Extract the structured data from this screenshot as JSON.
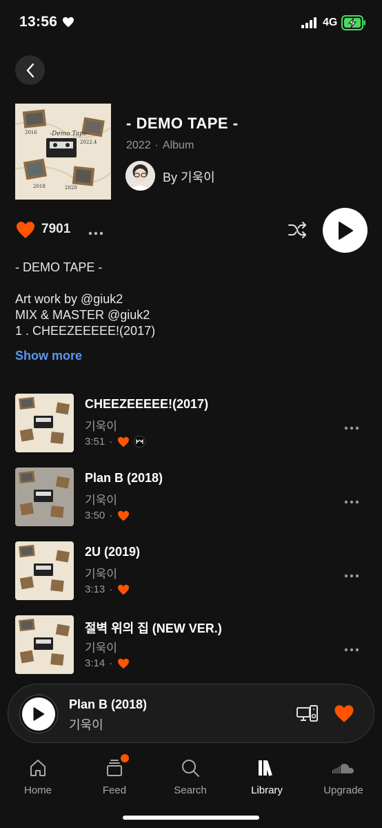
{
  "status_bar": {
    "time": "13:56",
    "network": "4G",
    "icons": [
      "heart-icon",
      "signal-icon",
      "battery-charging-icon"
    ]
  },
  "album": {
    "title": "- DEMO TAPE -",
    "year": "2022",
    "separator": "·",
    "type": "Album",
    "artist_line": "By 기욱이",
    "likes": "7901",
    "description": "- DEMO TAPE -\n\nArt work by @giuk2\nMIX & MASTER @giuk2\n1 . CHEEZEEEEE!(2017)",
    "show_more": "Show more",
    "artwork": {
      "handwritten_title": "-Demo Tape-",
      "note_2016": "2016",
      "note_2022": "2022.4",
      "note_2018": "2018",
      "note_2020": "2020"
    }
  },
  "tracks": [
    {
      "title": "CHEEZEEEEE!(2017)",
      "artist": "기욱이",
      "duration": "3:51",
      "separator": "·",
      "liked": true,
      "has_badge": true
    },
    {
      "title": "Plan B (2018)",
      "artist": "기욱이",
      "duration": "3:50",
      "separator": "·",
      "liked": true,
      "has_badge": false,
      "playing": true
    },
    {
      "title": "2U (2019)",
      "artist": "기욱이",
      "duration": "3:13",
      "separator": "·",
      "liked": true,
      "has_badge": false
    },
    {
      "title": "절벽 위의 집 (NEW VER.)",
      "artist": "기욱이",
      "duration": "3:14",
      "separator": "·",
      "liked": true,
      "has_badge": false
    }
  ],
  "mini_player": {
    "title": "Plan B (2018)",
    "artist": "기욱이",
    "progress": 0.02
  },
  "tabs": [
    {
      "label": "Home",
      "icon": "home-icon",
      "active": false
    },
    {
      "label": "Feed",
      "icon": "feed-icon",
      "active": false,
      "notification": true
    },
    {
      "label": "Search",
      "icon": "search-icon",
      "active": false
    },
    {
      "label": "Library",
      "icon": "library-icon",
      "active": true
    },
    {
      "label": "Upgrade",
      "icon": "soundcloud-icon",
      "active": false
    }
  ],
  "colors": {
    "background": "#121212",
    "accent": "#ff5500",
    "link": "#5a98f0",
    "secondary_text": "#9a9a9a"
  }
}
